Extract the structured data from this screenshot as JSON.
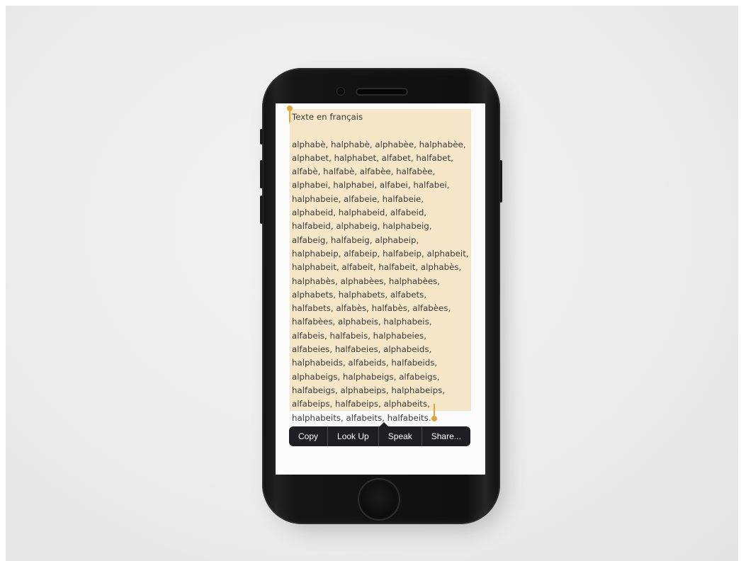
{
  "document": {
    "title": "Texte en français",
    "lines": [
      "alphabè, halphabè, alphabèe, halphabèe,",
      "alphabet, halphabet, alfabet, halfabet,",
      "alfabè, halfabè, alfabèe, halfabèe,",
      "alphabei, halphabei, alfabei, halfabei,",
      "halphabeie, alfabeie, halfabeie,",
      "alphabeid, halphabeid, alfabeid,",
      "halfabeid, alphabeig, halphabeig,",
      "alfabeig, halfabeig, alphabeip,",
      "halphabeip, alfabeip, halfabeip, alphabeit,",
      "halphabeit, alfabeit, halfabeit, alphabès,",
      "halphabès, alphabèes, halphabèes,",
      "alphabets, halphabets, alfabets,",
      "halfabets, alfabès, halfabès, alfabèes,",
      "halfabèes, alphabeis, halphabeis,",
      "alfabeis, halfabeis, halphabeies,",
      "alfabeies, halfabeies, alphabeids,",
      "halphabeids, alfabeids, halfabeids,",
      "alphabeigs, halphabeigs, alfabeigs,",
      "halfabeigs, alphabeips, halphabeips,",
      "alfabeips, halfabeips, alphabeits,",
      "halphabeits, alfabeits, halfabeits."
    ]
  },
  "edit_menu": {
    "items": [
      "Copy",
      "Look Up",
      "Speak",
      "Share..."
    ]
  },
  "colors": {
    "selection_highlight": "#f4e6c7",
    "selection_handle": "#e1a735",
    "menu_background": "#1f1f21",
    "phone_body": "#111111"
  }
}
